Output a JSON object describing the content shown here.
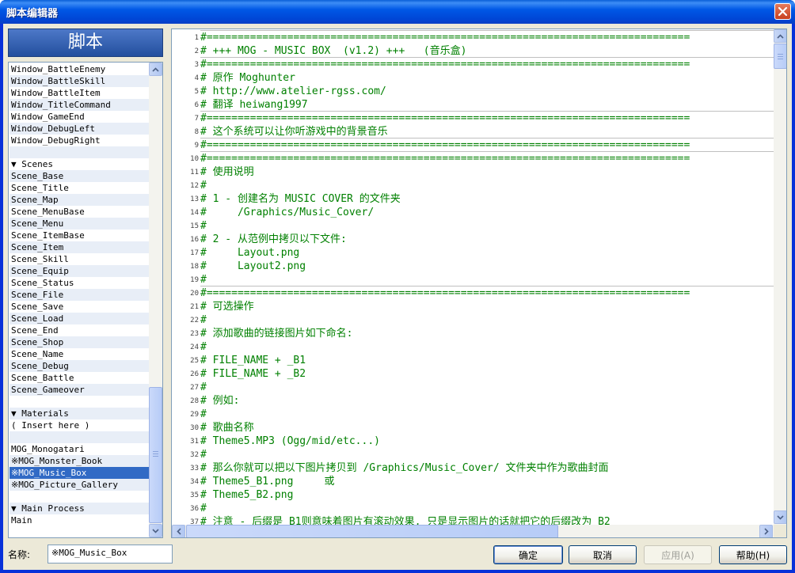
{
  "window": {
    "title": "脚本编辑器"
  },
  "sidebar": {
    "header": "脚本",
    "items": [
      {
        "label": "Window_BattleEnemy"
      },
      {
        "label": "Window_BattleSkill"
      },
      {
        "label": "Window_BattleItem"
      },
      {
        "label": "Window_TitleCommand"
      },
      {
        "label": "Window_GameEnd"
      },
      {
        "label": "Window_DebugLeft"
      },
      {
        "label": "Window_DebugRight"
      },
      {
        "label": ""
      },
      {
        "label": "▼ Scenes"
      },
      {
        "label": "Scene_Base"
      },
      {
        "label": "Scene_Title"
      },
      {
        "label": "Scene_Map"
      },
      {
        "label": "Scene_MenuBase"
      },
      {
        "label": "Scene_Menu"
      },
      {
        "label": "Scene_ItemBase"
      },
      {
        "label": "Scene_Item"
      },
      {
        "label": "Scene_Skill"
      },
      {
        "label": "Scene_Equip"
      },
      {
        "label": "Scene_Status"
      },
      {
        "label": "Scene_File"
      },
      {
        "label": "Scene_Save"
      },
      {
        "label": "Scene_Load"
      },
      {
        "label": "Scene_End"
      },
      {
        "label": "Scene_Shop"
      },
      {
        "label": "Scene_Name"
      },
      {
        "label": "Scene_Debug"
      },
      {
        "label": "Scene_Battle"
      },
      {
        "label": "Scene_Gameover"
      },
      {
        "label": ""
      },
      {
        "label": "▼ Materials"
      },
      {
        "label": "( Insert here )"
      },
      {
        "label": ""
      },
      {
        "label": "MOG_Monogatari"
      },
      {
        "label": "※MOG_Monster_Book"
      },
      {
        "label": "※MOG_Music_Box"
      },
      {
        "label": "※MOG_Picture_Gallery"
      },
      {
        "label": ""
      },
      {
        "label": "▼ Main Process"
      },
      {
        "label": "Main"
      }
    ],
    "selected_index": 34
  },
  "editor": {
    "lines": [
      {
        "n": "1",
        "text": "#=============================================================================="
      },
      {
        "n": "2",
        "text": "# +++ MOG - MUSIC BOX  (v1.2) +++   (音乐盒)"
      },
      {
        "n": "3",
        "text": "#=============================================================================="
      },
      {
        "n": "4",
        "text": "# 原作 Moghunter"
      },
      {
        "n": "5",
        "text": "# http://www.atelier-rgss.com/"
      },
      {
        "n": "6",
        "text": "# 翻译 heiwang1997"
      },
      {
        "n": "7",
        "text": "#=============================================================================="
      },
      {
        "n": "8",
        "text": "# 这个系统可以让你听游戏中的背景音乐"
      },
      {
        "n": "9",
        "text": "#=============================================================================="
      },
      {
        "n": "10",
        "text": "#=============================================================================="
      },
      {
        "n": "11",
        "text": "# 使用说明"
      },
      {
        "n": "12",
        "text": "#"
      },
      {
        "n": "13",
        "text": "# 1 - 创建名为 MUSIC COVER 的文件夹"
      },
      {
        "n": "14",
        "text": "#     /Graphics/Music_Cover/"
      },
      {
        "n": "15",
        "text": "#"
      },
      {
        "n": "16",
        "text": "# 2 - 从范例中拷贝以下文件:"
      },
      {
        "n": "17",
        "text": "#     Layout.png"
      },
      {
        "n": "18",
        "text": "#     Layout2.png"
      },
      {
        "n": "19",
        "text": "#"
      },
      {
        "n": "20",
        "text": "#=============================================================================="
      },
      {
        "n": "21",
        "text": "# 可选操作"
      },
      {
        "n": "22",
        "text": "#"
      },
      {
        "n": "23",
        "text": "# 添加歌曲的链接图片如下命名:"
      },
      {
        "n": "24",
        "text": "#"
      },
      {
        "n": "25",
        "text": "# FILE_NAME + _B1"
      },
      {
        "n": "26",
        "text": "# FILE_NAME + _B2"
      },
      {
        "n": "27",
        "text": "#"
      },
      {
        "n": "28",
        "text": "# 例如:"
      },
      {
        "n": "29",
        "text": "#"
      },
      {
        "n": "30",
        "text": "# 歌曲名称"
      },
      {
        "n": "31",
        "text": "# Theme5.MP3 (Ogg/mid/etc...)"
      },
      {
        "n": "32",
        "text": "#"
      },
      {
        "n": "33",
        "text": "# 那么你就可以把以下图片拷贝到 /Graphics/Music_Cover/ 文件夹中作为歌曲封面"
      },
      {
        "n": "34",
        "text": "# Theme5_B1.png     或"
      },
      {
        "n": "35",
        "text": "# Theme5_B2.png"
      },
      {
        "n": "36",
        "text": "#"
      },
      {
        "n": "37",
        "text": "# 注意 - 后缀是 B1则意味着图片有滚动效果, 只是显示图片的话就把它的后缀改为 B2"
      }
    ]
  },
  "footer": {
    "name_label": "名称:",
    "name_value": "※MOG_Music_Box",
    "ok": "确定",
    "cancel": "取消",
    "apply": "应用(A)",
    "help": "帮助(H)"
  }
}
